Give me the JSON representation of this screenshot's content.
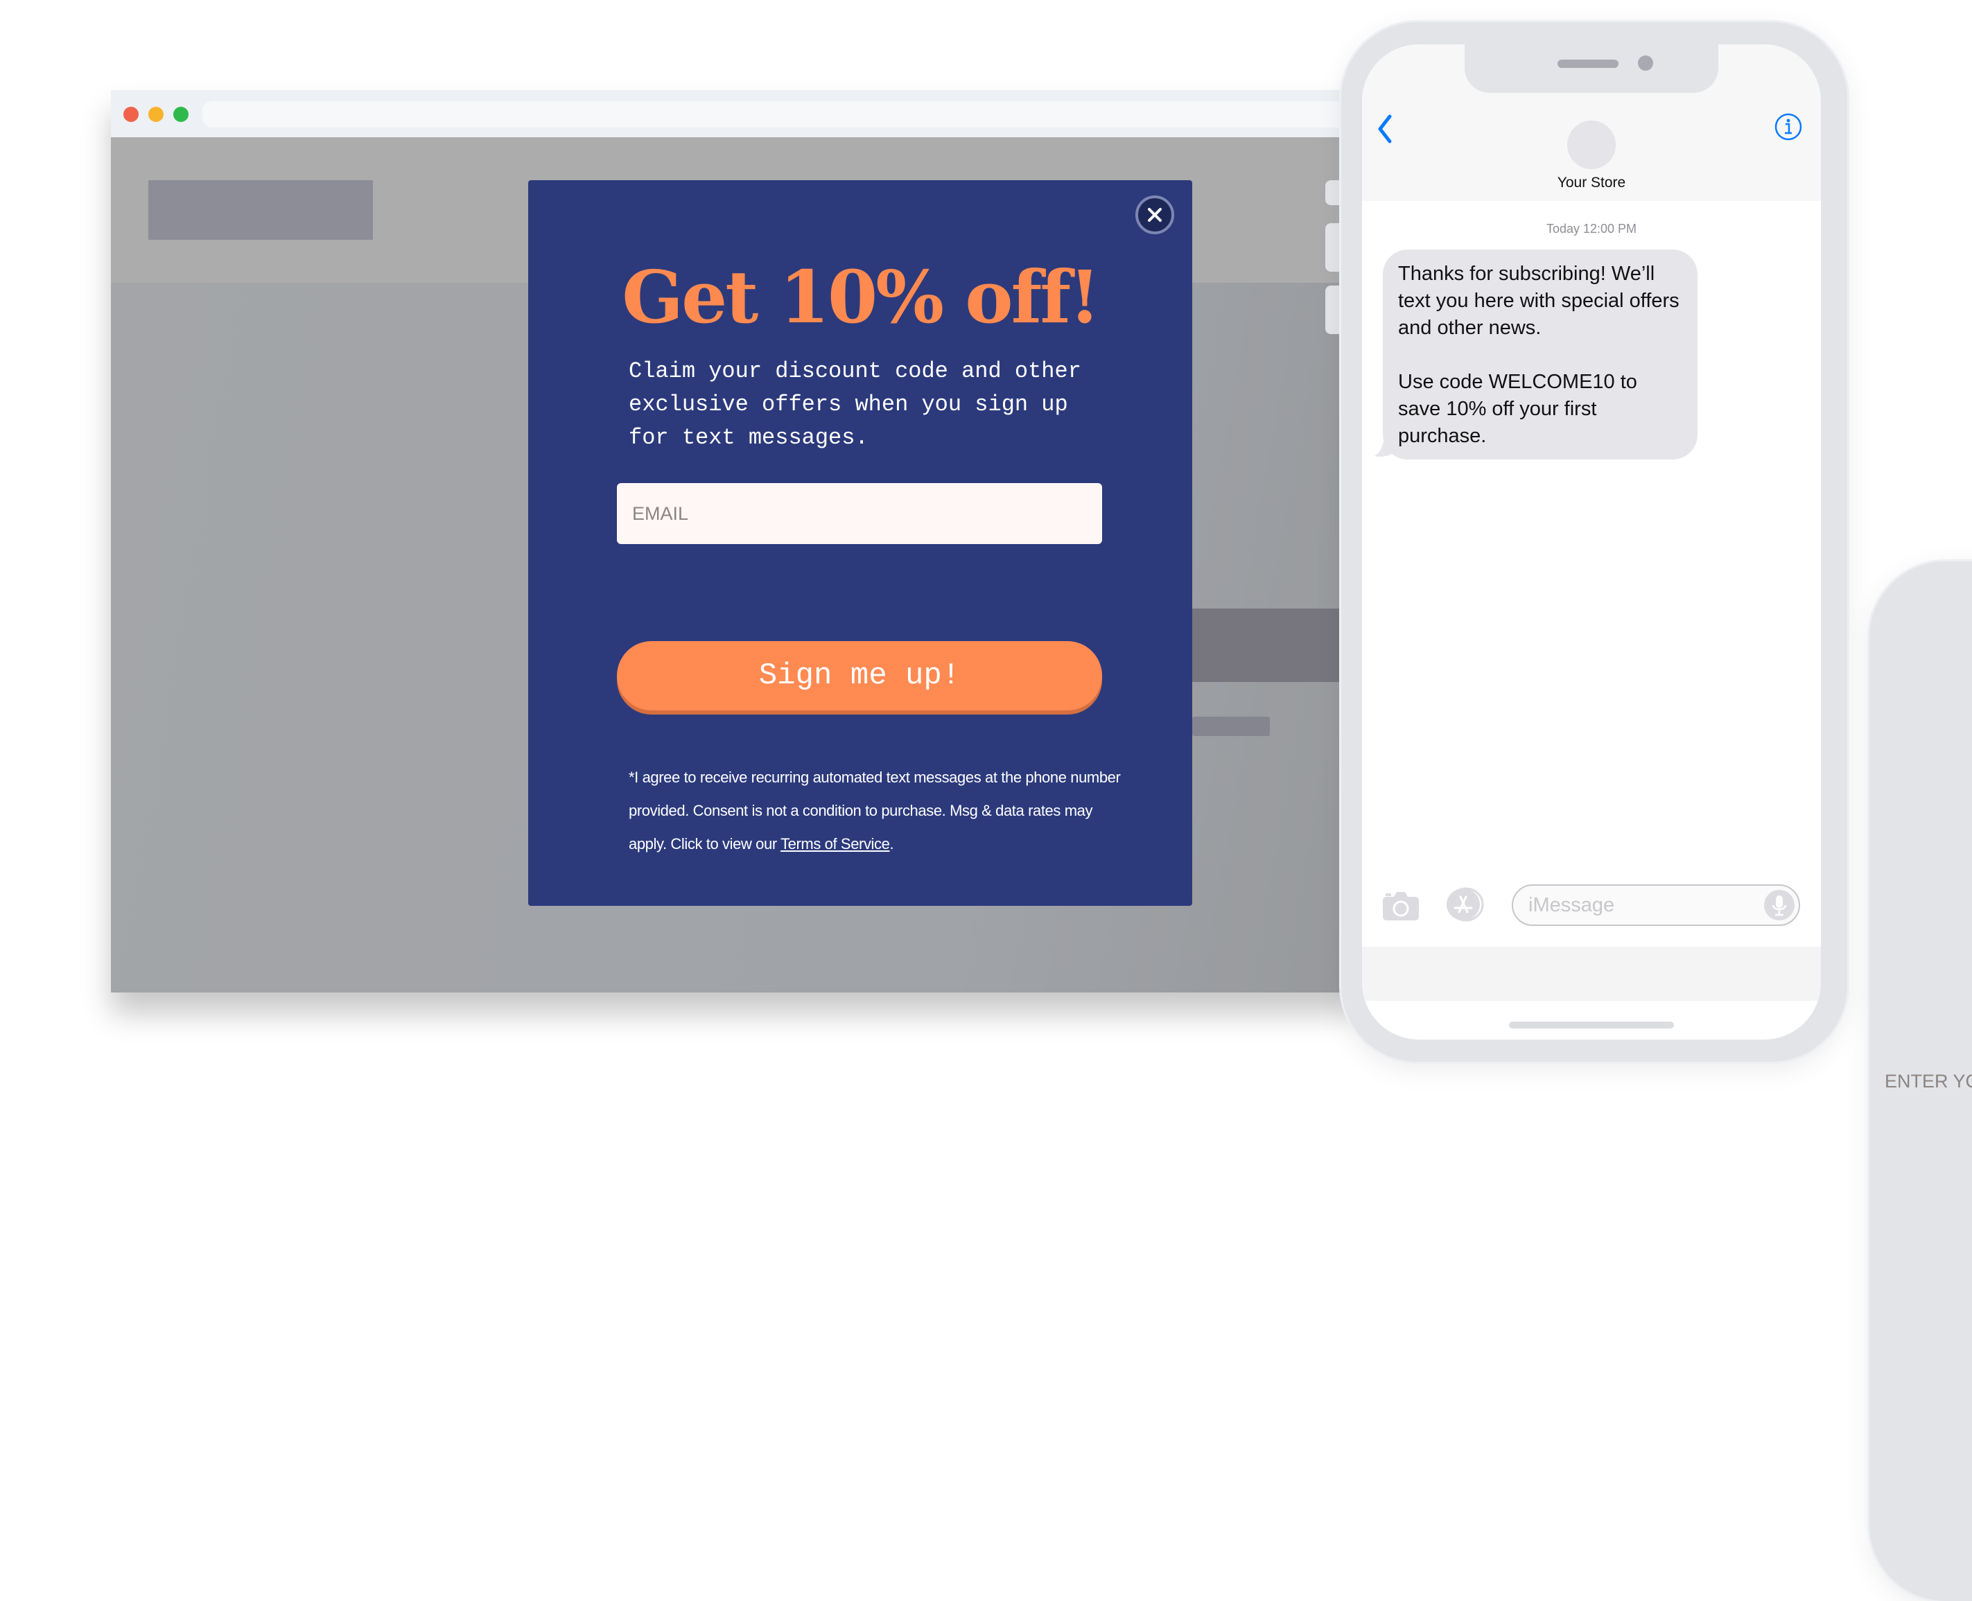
{
  "browser": {
    "window_controls": [
      "close",
      "minimize",
      "maximize"
    ]
  },
  "popup": {
    "close_icon": "close-x-icon",
    "headline": "Get 10% off!",
    "subtext": "Claim your discount code and other exclusive offers when you sign up for text messages.",
    "email_placeholder": "EMAIL",
    "phone_placeholder": "ENTER YOUR MOBILE PHONE NUMBER",
    "email_value": "",
    "phone_value": "",
    "submit_label": "Sign me up!",
    "legal_text": "*I agree to receive recurring automated text messages at the phone number provided. Consent is not a condition to purchase. Msg & data rates may apply. Click to view our ",
    "terms_link": "Terms of Service",
    "legal_end": ".",
    "colors": {
      "background": "#2c3a7c",
      "accent": "#ff8a50",
      "field_bg": "#fef7f6"
    }
  },
  "phone": {
    "back_icon": "chevron-left-icon",
    "info_icon": "info-icon",
    "contact_name": "Your Store",
    "timestamp": "Today 12:00 PM",
    "messages": [
      {
        "from": "Your Store",
        "paragraphs": [
          "Thanks for subscribing! We’ll text you here with special offers and other news.",
          "Use code WELCOME10 to save 10% off your first purchase."
        ]
      }
    ],
    "input_placeholder": "iMessage",
    "input_value": "",
    "accent_color": "#0a7aff"
  }
}
